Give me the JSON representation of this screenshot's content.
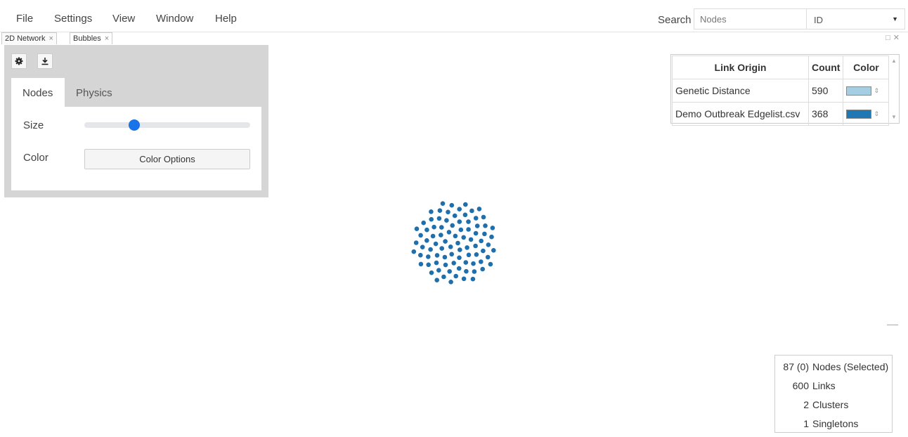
{
  "menu": [
    "File",
    "Settings",
    "View",
    "Window",
    "Help"
  ],
  "search": {
    "label": "Search",
    "placeholder": "Nodes",
    "field": "ID"
  },
  "tabs": [
    {
      "label": "2D Network",
      "close": "×"
    },
    {
      "label": "Bubbles",
      "close": "×"
    }
  ],
  "panel": {
    "tabs": [
      "Nodes",
      "Physics"
    ],
    "active_tab": "Nodes",
    "size_label": "Size",
    "size_value": 0.3,
    "color_label": "Color",
    "color_button": "Color Options"
  },
  "link_table": {
    "headers": [
      "Link Origin",
      "Count",
      "Color"
    ],
    "rows": [
      {
        "origin": "Genetic Distance",
        "count": "590",
        "color": "#a6cee3"
      },
      {
        "origin": "Demo Outbreak Edgelist.csv",
        "count": "368",
        "color": "#1f78b4"
      }
    ]
  },
  "stats": [
    {
      "value": "87 (0)",
      "label": "Nodes (Selected)"
    },
    {
      "value": "600",
      "label": "Links"
    },
    {
      "value": "2",
      "label": "Clusters"
    },
    {
      "value": "1",
      "label": "Singletons"
    }
  ],
  "node_color": "#1f6fad",
  "accent_color": "#1a73e8",
  "icons": [
    "gear-icon",
    "download-icon",
    "caret-down-icon",
    "close-icon",
    "maximize-icon"
  ]
}
